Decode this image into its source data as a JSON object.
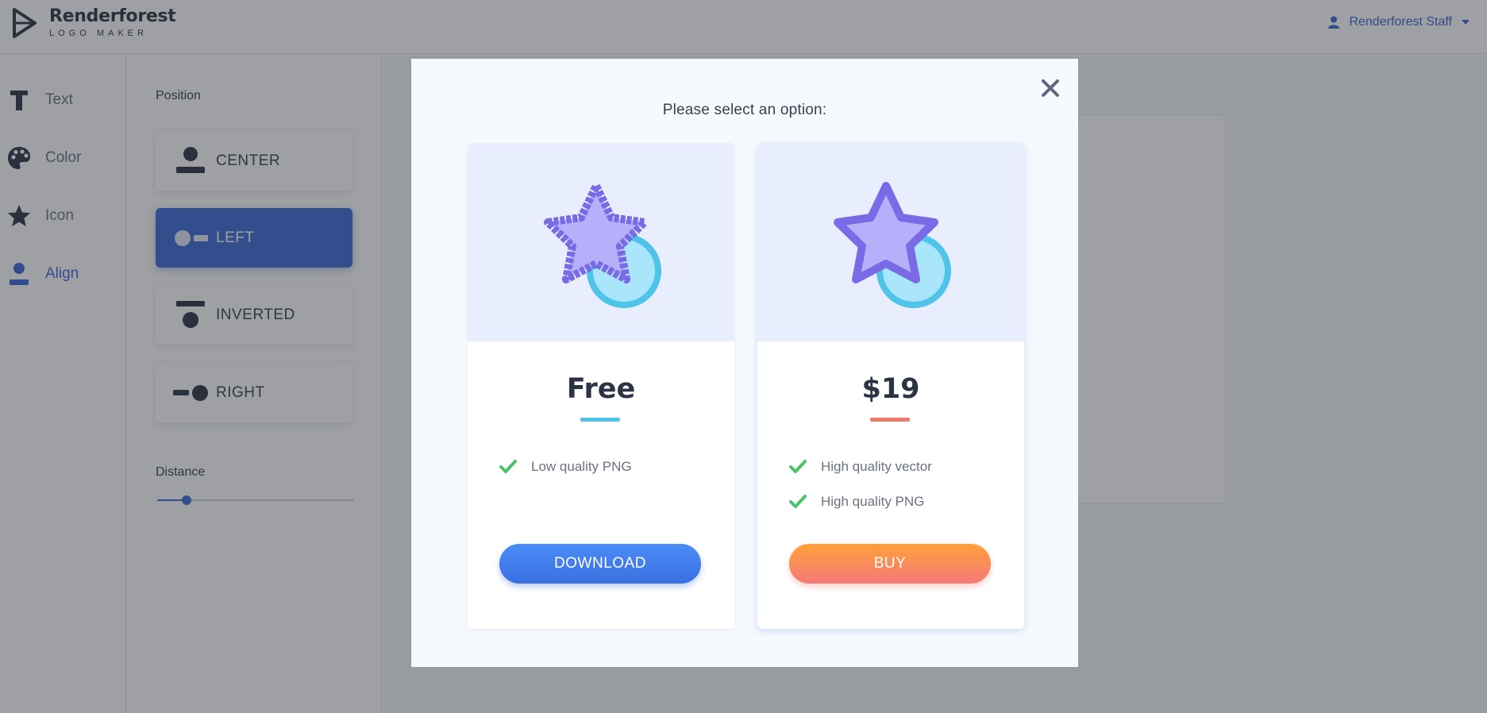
{
  "header": {
    "logo_name": "Renderforest",
    "logo_sub": "LOGO MAKER",
    "user_name": "Renderforest Staff"
  },
  "sidebar": {
    "items": [
      {
        "label": "Text",
        "icon": "text-icon"
      },
      {
        "label": "Color",
        "icon": "palette-icon"
      },
      {
        "label": "Icon",
        "icon": "star-icon"
      },
      {
        "label": "Align",
        "icon": "user-icon",
        "active": true
      }
    ]
  },
  "options": {
    "position_title": "Position",
    "positions": [
      {
        "label": "CENTER"
      },
      {
        "label": "LEFT",
        "active": true
      },
      {
        "label": "INVERTED"
      },
      {
        "label": "RIGHT"
      }
    ],
    "distance_title": "Distance",
    "distance_value": 0.15
  },
  "modal": {
    "title": "Please select an option:",
    "cards": [
      {
        "price": "Free",
        "features": [
          "Low quality PNG"
        ],
        "button": "DOWNLOAD",
        "underline_color": "#4fc3e8"
      },
      {
        "price": "$19",
        "features": [
          "High quality vector",
          "High quality PNG"
        ],
        "button": "BUY",
        "underline_color": "#ee7b6a"
      }
    ]
  },
  "colors": {
    "accent_blue": "#3d6bd8",
    "check_green": "#4cc36a",
    "star_fill": "#b6b0fb",
    "star_stroke": "#7a6ae6",
    "circle_fill": "#a9e6fb",
    "circle_stroke": "#4fc3e8"
  }
}
